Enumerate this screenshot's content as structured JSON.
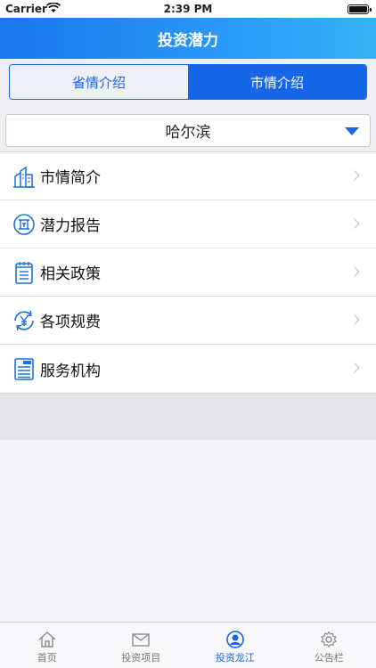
{
  "status_bar": {
    "carrier": "Carrier",
    "time": "2:39 PM"
  },
  "nav": {
    "title": "投资潜力"
  },
  "segment": {
    "options": [
      {
        "label": "省情介绍",
        "selected": false
      },
      {
        "label": "市情介绍",
        "selected": true
      }
    ]
  },
  "city_select": {
    "value": "哈尔滨"
  },
  "menu": {
    "items": [
      {
        "label": "市情简介",
        "icon": "city-buildings-icon"
      },
      {
        "label": "潜力报告",
        "icon": "report-badge-icon"
      },
      {
        "label": "相关政策",
        "icon": "notepad-icon"
      },
      {
        "label": "各项规费",
        "icon": "yen-refresh-icon"
      },
      {
        "label": "服务机构",
        "icon": "news-icon"
      }
    ]
  },
  "tabs": [
    {
      "label": "首页",
      "icon": "home-icon",
      "active": false
    },
    {
      "label": "投资项目",
      "icon": "mail-icon",
      "active": false
    },
    {
      "label": "投资龙江",
      "icon": "user-icon",
      "active": true
    },
    {
      "label": "公告栏",
      "icon": "gear-icon",
      "active": false
    }
  ],
  "colors": {
    "primary": "#1766e8",
    "nav_gradient_start": "#1877ee",
    "nav_gradient_end": "#35b3f8",
    "tab_inactive": "#777777"
  }
}
